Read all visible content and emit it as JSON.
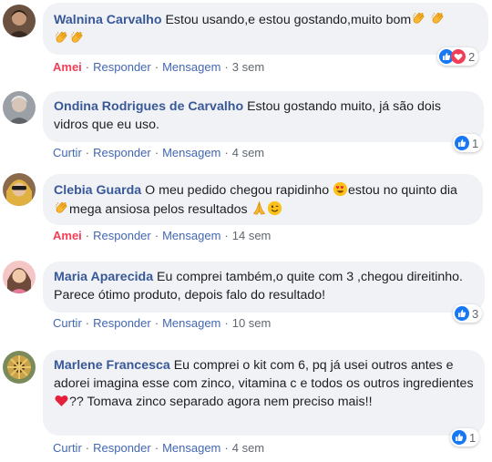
{
  "comments": [
    {
      "name": "Walnina Carvalho",
      "text_1": "Estou usando,e estou gostando,muito bom",
      "action_like": "Amei",
      "action_reply": "Responder",
      "action_message": "Mensagem",
      "time": "3 sem",
      "reaction_count": "2",
      "reaction_icons": [
        "like-icon",
        "love-icon"
      ],
      "inline_emojis": [
        "clapping-hands-emoji",
        "clapping-hands-emoji",
        "clapping-hands-emoji",
        "clapping-hands-emoji"
      ]
    },
    {
      "name": "Ondina Rodrigues de Carvalho",
      "text_1": "Estou gostando muito, já são dois vidros que eu uso.",
      "action_like": "Curtir",
      "action_reply": "Responder",
      "action_message": "Mensagem",
      "time": "4 sem",
      "reaction_count": "1",
      "reaction_icons": [
        "like-icon"
      ]
    },
    {
      "name": "Clebia Guarda",
      "text_1": "O meu pedido chegou rapidinho",
      "text_2": "estou no quinto dia",
      "text_3": "mega ansiosa pelos resultados",
      "action_like": "Amei",
      "action_reply": "Responder",
      "action_message": "Mensagem",
      "time": "14 sem",
      "inline_emojis": [
        "heart-eyes-emoji",
        "clapping-hands-emoji",
        "praying-hands-emoji",
        "wink-emoji"
      ]
    },
    {
      "name": "Maria Aparecida",
      "text_1": "Eu comprei também,o quite com 3 ,chegou direitinho. Parece ótimo produto, depois falo do resultado!",
      "action_like": "Curtir",
      "action_reply": "Responder",
      "action_message": "Mensagem",
      "time": "10 sem",
      "reaction_count": "3",
      "reaction_icons": [
        "like-icon"
      ]
    },
    {
      "name": "Marlene Francesca",
      "text_1": "Eu comprei o kit com 6, pq já usei outros antes e adorei imagina esse com zinco, vitamina c e todos os outros ingredientes",
      "text_2": "?? Tomava zinco separado agora nem preciso mais!!",
      "action_like": "Curtir",
      "action_reply": "Responder",
      "action_message": "Mensagem",
      "time": "4 sem",
      "reaction_count": "1",
      "reaction_icons": [
        "like-icon"
      ],
      "inline_emojis": [
        "red-heart-emoji"
      ]
    }
  ],
  "colors": {
    "name_blue": "#385898",
    "action_blue": "#4267b2",
    "love_red": "#f33e58",
    "bubble_gray": "#f0f2f5",
    "like_blue": "#1877f2"
  }
}
